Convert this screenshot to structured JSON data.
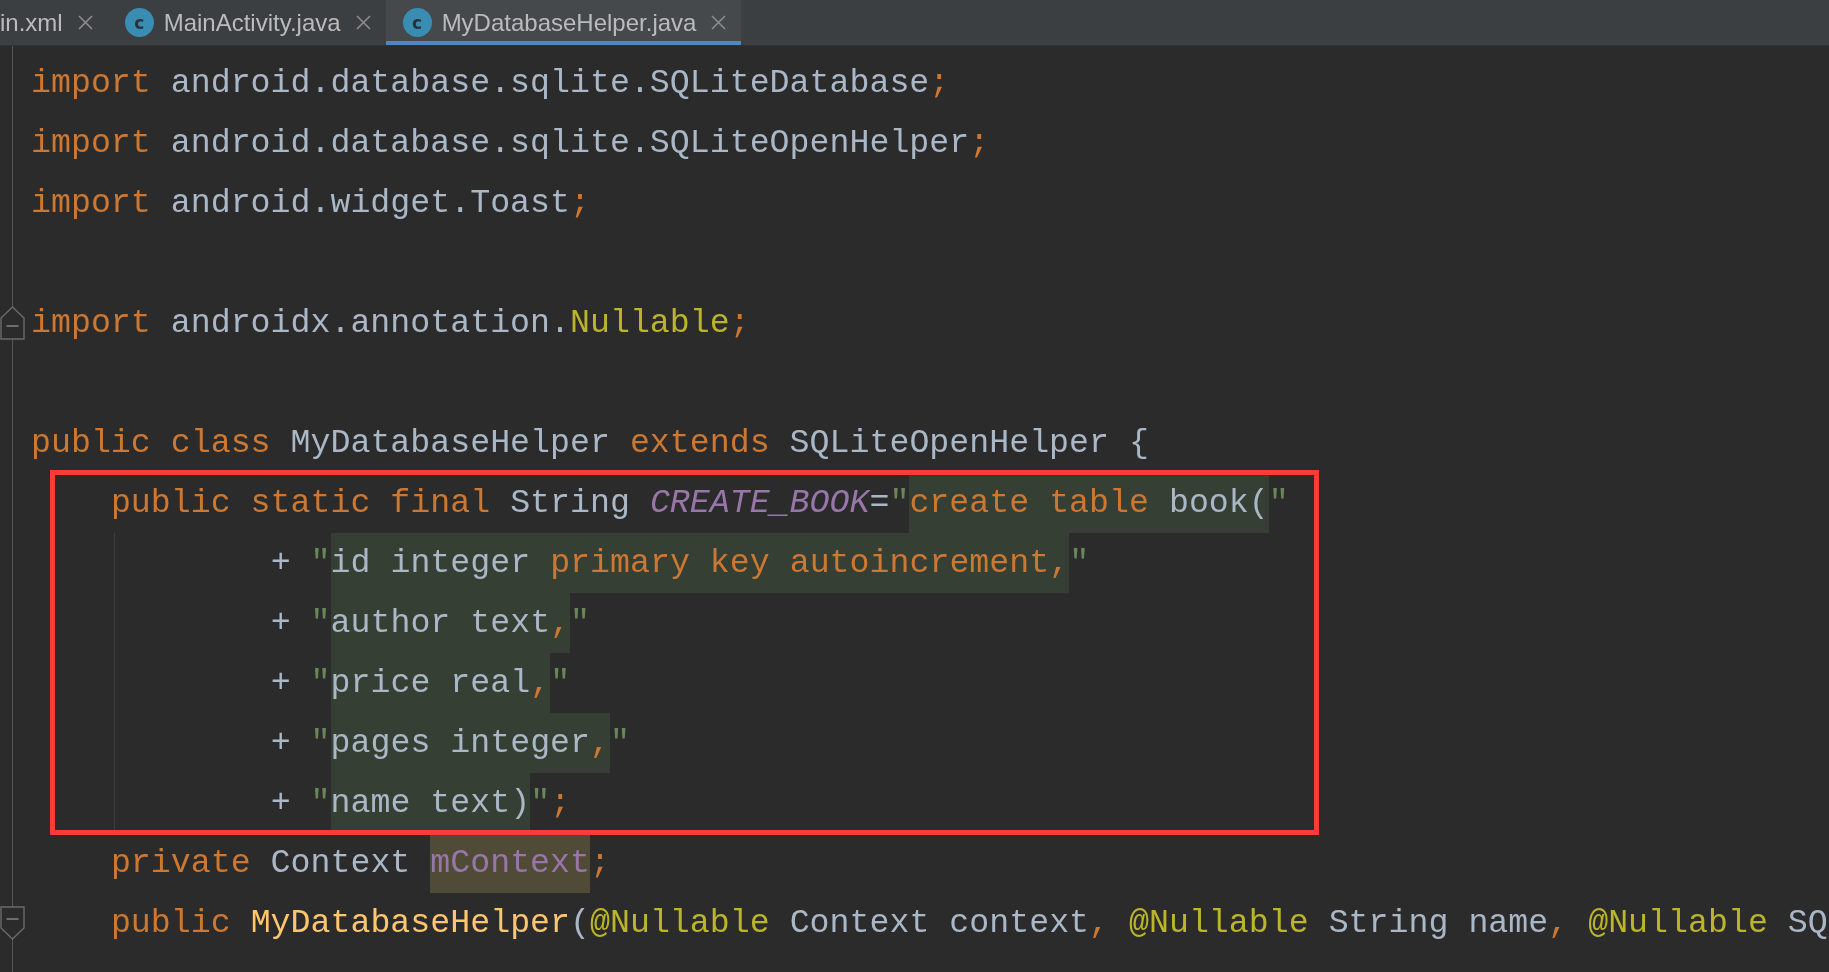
{
  "tabs": [
    {
      "label": "in.xml",
      "selected": false
    },
    {
      "label": "MainActivity.java",
      "icon_letter": "c",
      "selected": false
    },
    {
      "label": "MyDatabaseHelper.java",
      "icon_letter": "c",
      "selected": true
    }
  ],
  "editor": {
    "lines": [
      {
        "kind": "code",
        "tokens": [
          {
            "text": "import",
            "kind": "keyword"
          },
          {
            "text": " android.database.sqlite.SQLiteDatabase",
            "kind": "plain"
          },
          {
            "text": ";",
            "kind": "punct"
          }
        ]
      },
      {
        "kind": "code",
        "tokens": [
          {
            "text": "import",
            "kind": "keyword"
          },
          {
            "text": " android.database.sqlite.SQLiteOpenHelper",
            "kind": "plain"
          },
          {
            "text": ";",
            "kind": "punct"
          }
        ]
      },
      {
        "kind": "code",
        "tokens": [
          {
            "text": "import",
            "kind": "keyword"
          },
          {
            "text": " android.widget.Toast",
            "kind": "plain"
          },
          {
            "text": ";",
            "kind": "punct"
          }
        ]
      },
      {
        "kind": "blank"
      },
      {
        "kind": "code",
        "fold_end": true,
        "tokens": [
          {
            "text": "import",
            "kind": "keyword"
          },
          {
            "text": " androidx.annotation.",
            "kind": "plain"
          },
          {
            "text": "Nullable",
            "kind": "annotation"
          },
          {
            "text": ";",
            "kind": "punct"
          }
        ]
      },
      {
        "kind": "blank"
      },
      {
        "kind": "code",
        "tokens": [
          {
            "text": "public class",
            "kind": "keyword"
          },
          {
            "text": " MyDatabaseHelper ",
            "kind": "plain"
          },
          {
            "text": "extends",
            "kind": "keyword"
          },
          {
            "text": " SQLiteOpenHelper {",
            "kind": "plain"
          }
        ],
        "children": [
          {
            "kind": "code",
            "boxed": true,
            "tokens": [
              {
                "text": "public static final",
                "kind": "keyword"
              },
              {
                "text": " String ",
                "kind": "plain"
              },
              {
                "text": "CREATE_BOOK",
                "kind": "constant"
              },
              {
                "text": "=",
                "kind": "plain"
              },
              {
                "text": "\"",
                "kind": "quote"
              },
              {
                "text": "create table",
                "kind": "sql_keyword",
                "injected": true
              },
              {
                "text": " book(",
                "kind": "plain",
                "injected": true
              },
              {
                "text": "\"",
                "kind": "quote"
              }
            ],
            "children": [
              {
                "kind": "code",
                "tokens": [
                  {
                    "text": "+ ",
                    "kind": "plain"
                  },
                  {
                    "text": "\"",
                    "kind": "quote"
                  },
                  {
                    "text": "id integer ",
                    "kind": "plain",
                    "injected": true
                  },
                  {
                    "text": "primary key autoincrement,",
                    "kind": "sql_keyword",
                    "injected": true
                  },
                  {
                    "text": "\"",
                    "kind": "quote"
                  }
                ]
              },
              {
                "kind": "code",
                "tokens": [
                  {
                    "text": "+ ",
                    "kind": "plain"
                  },
                  {
                    "text": "\"",
                    "kind": "quote"
                  },
                  {
                    "text": "author text",
                    "kind": "plain",
                    "injected": true
                  },
                  {
                    "text": ",",
                    "kind": "sql_keyword",
                    "injected": true
                  },
                  {
                    "text": "\"",
                    "kind": "quote"
                  }
                ]
              },
              {
                "kind": "code",
                "tokens": [
                  {
                    "text": "+ ",
                    "kind": "plain"
                  },
                  {
                    "text": "\"",
                    "kind": "quote"
                  },
                  {
                    "text": "price real",
                    "kind": "plain",
                    "injected": true
                  },
                  {
                    "text": ",",
                    "kind": "sql_keyword",
                    "injected": true
                  },
                  {
                    "text": "\"",
                    "kind": "quote"
                  }
                ]
              },
              {
                "kind": "code",
                "tokens": [
                  {
                    "text": "+ ",
                    "kind": "plain"
                  },
                  {
                    "text": "\"",
                    "kind": "quote"
                  },
                  {
                    "text": "pages integer",
                    "kind": "plain",
                    "injected": true
                  },
                  {
                    "text": ",",
                    "kind": "sql_keyword",
                    "injected": true
                  },
                  {
                    "text": "\"",
                    "kind": "quote"
                  }
                ]
              },
              {
                "kind": "code",
                "tokens": [
                  {
                    "text": "+ ",
                    "kind": "plain"
                  },
                  {
                    "text": "\"",
                    "kind": "quote"
                  },
                  {
                    "text": "name text)",
                    "kind": "plain",
                    "injected": true
                  },
                  {
                    "text": "\"",
                    "kind": "quote"
                  },
                  {
                    "text": ";",
                    "kind": "punct"
                  }
                ]
              }
            ]
          },
          {
            "kind": "code",
            "tokens": [
              {
                "text": "private",
                "kind": "keyword"
              },
              {
                "text": " Context ",
                "kind": "plain"
              },
              {
                "text": "mContext",
                "kind": "field",
                "highlighted": true
              },
              {
                "text": ";",
                "kind": "punct"
              }
            ]
          },
          {
            "kind": "code",
            "fold_start": true,
            "tokens": [
              {
                "text": "public ",
                "kind": "keyword"
              },
              {
                "text": "MyDatabaseHelper",
                "kind": "method"
              },
              {
                "text": "(",
                "kind": "plain"
              },
              {
                "text": "@Nullable",
                "kind": "annotation"
              },
              {
                "text": " Context context",
                "kind": "plain"
              },
              {
                "text": ", ",
                "kind": "punct"
              },
              {
                "text": "@Nullable",
                "kind": "annotation"
              },
              {
                "text": " String name",
                "kind": "plain"
              },
              {
                "text": ", ",
                "kind": "punct"
              },
              {
                "text": "@Nullable",
                "kind": "annotation"
              },
              {
                "text": " SQ",
                "kind": "plain"
              }
            ]
          }
        ]
      }
    ]
  }
}
